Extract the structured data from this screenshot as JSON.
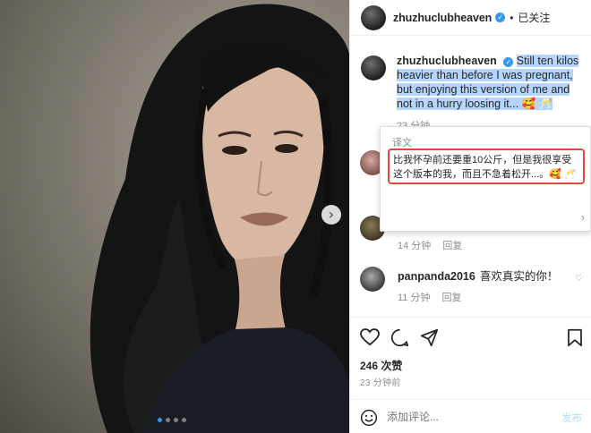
{
  "header": {
    "username": "zhuzhuclubheaven",
    "separator": "•",
    "follow_label": "已关注"
  },
  "caption": {
    "username": "zhuzhuclubheaven",
    "text": "Still ten kilos heavier than before I was pregnant, but enjoying this version of me and not in a hurry loosing it... 🥰 🥂",
    "meta_time": "23 分钟"
  },
  "translation": {
    "title": "译文",
    "text": "比我怀孕前还要重10公斤，但是我很享受这个版本的我，而且不急着松开...。🥰 🥂"
  },
  "comments": [
    {
      "time": "14 分钟",
      "reply": "回复"
    },
    {
      "username": "panpanda2016",
      "text": "喜欢真实的你！",
      "time": "11 分钟",
      "reply": "回复"
    }
  ],
  "likes": "246 次赞",
  "posted_time": "23 分钟前",
  "comment_input": {
    "placeholder": "添加评论..."
  },
  "post_label": "发布",
  "colors": {
    "accent": "#3897f0",
    "highlight": "#b4d5fe",
    "annotation": "#e8463a"
  },
  "carousel": {
    "total": 4,
    "active": 1
  }
}
